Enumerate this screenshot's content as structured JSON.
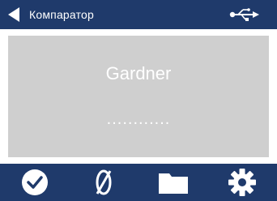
{
  "header": {
    "title": "Компаратор",
    "back_icon": "back-triangle-icon",
    "status_icon": "usb-icon"
  },
  "display": {
    "mode_label": "Gardner",
    "value": "............"
  },
  "toolbar": {
    "buttons": [
      {
        "icon": "check-circle-icon"
      },
      {
        "icon": "zero-icon"
      },
      {
        "icon": "folder-icon"
      },
      {
        "icon": "gear-icon"
      }
    ]
  },
  "colors": {
    "bar": "#1f3a6b",
    "screen": "#cfcfcf",
    "foreground": "#ffffff"
  }
}
